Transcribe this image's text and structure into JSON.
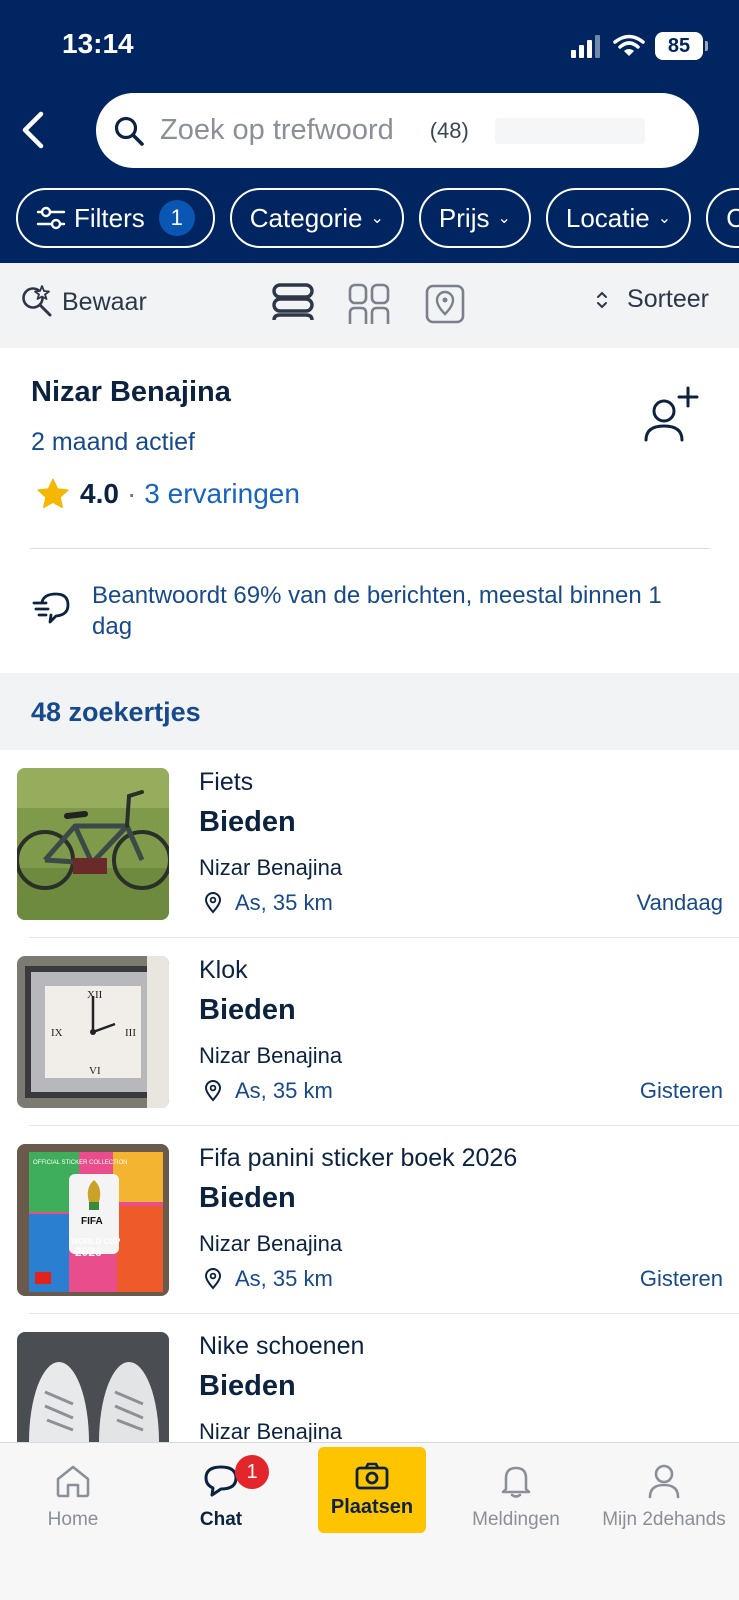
{
  "status_bar": {
    "time": "13:14",
    "battery": "85"
  },
  "search": {
    "placeholder": "Zoek op trefwoord",
    "count": "(48)"
  },
  "filters": {
    "chips": [
      {
        "label": "Filters",
        "badge": "1"
      },
      {
        "label": "Categorie"
      },
      {
        "label": "Prijs"
      },
      {
        "label": "Locatie"
      },
      {
        "label": "Co"
      }
    ]
  },
  "toolbar": {
    "save_label": "Bewaar",
    "sort_label": "Sorteer"
  },
  "seller": {
    "name": "Nizar Benajina",
    "active": "2 maand actief",
    "rating": "4.0",
    "reviews": "3 ervaringen",
    "response": "Beantwoordt  69% van de berichten, meestal binnen 1 dag"
  },
  "results": {
    "count_label": "48 zoekertjes"
  },
  "listings": [
    {
      "title": "Fiets",
      "price": "Bieden",
      "seller": "Nizar Benajina",
      "location": "As, 35 km",
      "date": "Vandaag",
      "image": "bicycle-on-grass"
    },
    {
      "title": "Klok",
      "price": "Bieden",
      "seller": "Nizar Benajina",
      "location": "As, 35 km",
      "date": "Gisteren",
      "image": "mirrored-wall-clock"
    },
    {
      "title": "Fifa panini sticker boek 2026",
      "price": "Bieden",
      "seller": "Nizar Benajina",
      "location": "As, 35 km",
      "date": "Gisteren",
      "image": "sticker-album-cover",
      "image_text": {
        "top": "OFFICIAL STICKER COLLECTION",
        "fifa": "FIFA",
        "wc": "WORLD CUP",
        "year": "2026"
      }
    },
    {
      "title": "Nike schoenen",
      "price": "Bieden",
      "seller": "Nizar Benajina",
      "location": "",
      "date": "",
      "image": "white-sneakers"
    }
  ],
  "bottom_nav": {
    "home": "Home",
    "chat": "Chat",
    "chat_badge": "1",
    "place": "Plaatsen",
    "notifications": "Meldingen",
    "account": "Mijn 2dehands"
  },
  "colors": {
    "header": "#002561",
    "accent": "#ffc400",
    "link": "#1565c0",
    "badge": "#e3262b"
  }
}
